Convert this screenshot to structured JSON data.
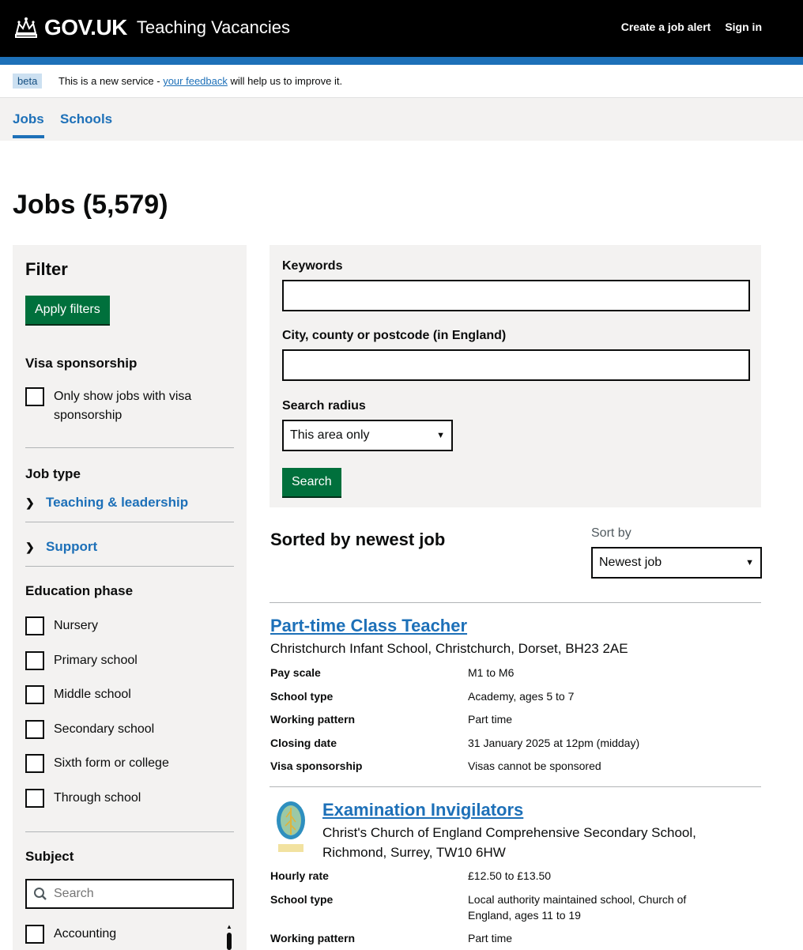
{
  "header": {
    "logo_text": "GOV.UK",
    "service_name": "Teaching Vacancies",
    "nav": [
      "Create a job alert",
      "Sign in"
    ]
  },
  "phase_banner": {
    "tag": "beta",
    "text_before": "This is a new service - ",
    "link": "your feedback",
    "text_after": " will help us to improve it."
  },
  "subnav": {
    "items": [
      "Jobs",
      "Schools"
    ],
    "active": "Jobs"
  },
  "page_title": "Jobs (5,579)",
  "filter": {
    "title": "Filter",
    "apply_label": "Apply filters",
    "visa": {
      "heading": "Visa sponsorship",
      "option": "Only show jobs with visa",
      "option_line2": "sponsorship"
    },
    "job_type": {
      "heading": "Job type",
      "accordions": [
        "Teaching & leadership",
        "Support"
      ]
    },
    "education_phase": {
      "heading": "Education phase",
      "options": [
        "Nursery",
        "Primary school",
        "Middle school",
        "Secondary school",
        "Sixth form or college",
        "Through school"
      ]
    },
    "subject": {
      "heading": "Subject",
      "search_placeholder": "Search",
      "options": [
        "Accounting"
      ]
    }
  },
  "search": {
    "keywords_label": "Keywords",
    "keywords_value": "",
    "location_label": "City, county or postcode (in England)",
    "location_value": "",
    "radius_label": "Search radius",
    "radius_value": "This area only",
    "button": "Search"
  },
  "sort": {
    "heading": "Sorted by newest job",
    "label": "Sort by",
    "value": "Newest job"
  },
  "jobs": [
    {
      "title": "Part-time Class Teacher",
      "school": "Christchurch Infant School, Christchurch, Dorset, BH23 2AE",
      "details": [
        {
          "label": "Pay scale",
          "value": "M1 to M6"
        },
        {
          "label": "School type",
          "value": "Academy, ages 5 to 7"
        },
        {
          "label": "Working pattern",
          "value": "Part time"
        },
        {
          "label": "Closing date",
          "value": "31 January 2025 at 12pm (midday)"
        },
        {
          "label": "Visa sponsorship",
          "value": "Visas cannot be sponsored"
        }
      ]
    },
    {
      "title": "Examination Invigilators",
      "school_line1": "Christ's Church of England Comprehensive Secondary School,",
      "school_line2": "Richmond, Surrey, TW10 6HW",
      "details": [
        {
          "label": "Hourly rate",
          "value": "£12.50 to £13.50"
        },
        {
          "label": "School type",
          "value": "Local authority maintained school, Church of",
          "value_line2": "England, ages 11 to 19"
        },
        {
          "label": "Working pattern",
          "value": "Part time"
        }
      ]
    }
  ],
  "colors": {
    "header_bg": "#000000",
    "brand_blue": "#1d70b8",
    "button_green": "#00703c",
    "panel_grey": "#f3f2f1"
  }
}
